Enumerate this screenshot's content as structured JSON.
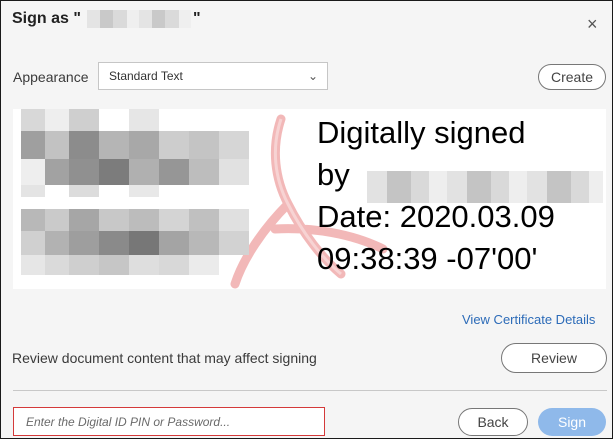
{
  "dialog": {
    "title_prefix": "Sign as \"",
    "title_suffix": "\"",
    "close_glyph": "×"
  },
  "appearance": {
    "label": "Appearance",
    "selected": "Standard Text",
    "chevron_glyph": "⌄",
    "create_label": "Create"
  },
  "preview": {
    "line1": "Digitally signed",
    "line2": "by",
    "line3": "Date: 2020.03.09",
    "line4": "09:38:39 -07'00'",
    "logo": "acrobat-logo-watermark",
    "logo_color": "#f2b8b8"
  },
  "certificate_link": "View Certificate Details",
  "review": {
    "text": "Review document content that may affect signing",
    "button_label": "Review"
  },
  "pin": {
    "placeholder": "Enter the Digital ID PIN or Password..."
  },
  "footer": {
    "back_label": "Back",
    "sign_label": "Sign"
  },
  "colors": {
    "link": "#2c6bb8",
    "sign_button": "#8fb9ea",
    "error_border": "#d43a3a"
  }
}
